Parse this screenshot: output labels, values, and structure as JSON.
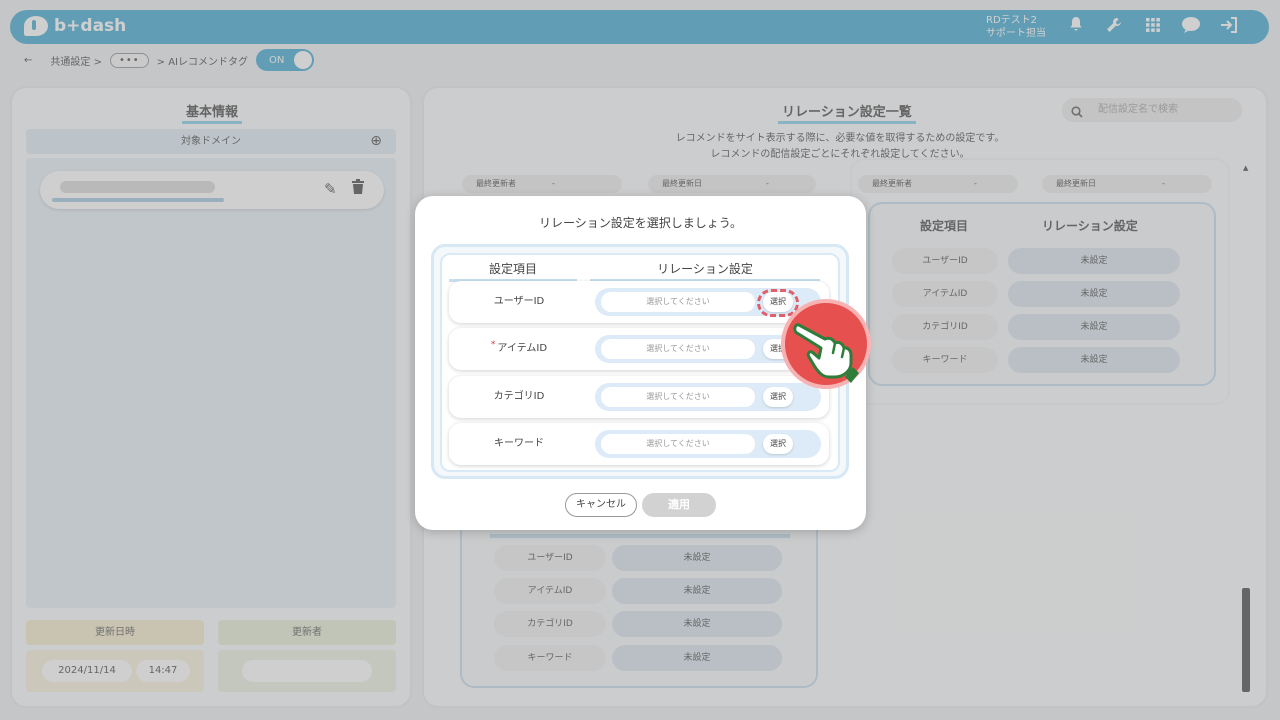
{
  "header": {
    "logo_text": "b+dash",
    "user_line1": "RDテスト2",
    "user_line2": "サポート担当",
    "icons": [
      "bell-icon",
      "wrench-icon",
      "grid-icon",
      "chat-icon",
      "logout-icon"
    ]
  },
  "breadcrumb": {
    "back": "←",
    "item1": "共通設定 >",
    "dots": "•••",
    "item2": "> AIレコメンドタグ",
    "toggle_label": "ON"
  },
  "left_panel": {
    "title": "基本情報",
    "domain_header": "対象ドメイン",
    "updated_at_label": "更新日時",
    "updater_label": "更新者",
    "date": "2024/11/14",
    "time": "14:47"
  },
  "right_panel": {
    "title": "リレーション設定一覧",
    "search_placeholder": "配信設定名で検索",
    "desc_line1": "レコメンドをサイト表示する際に、必要な値を取得するための設定です。",
    "desc_line2": "レコメンドの配信設定ごとにそれぞれ設定してください。",
    "last_updater": "最終更新者",
    "last_updated": "最終更新日",
    "dash": "-",
    "col_item": "設定項目",
    "col_relation": "リレーション設定",
    "rows": [
      {
        "label": "ユーザーID",
        "value": "未設定"
      },
      {
        "label": "アイテムID",
        "value": "未設定"
      },
      {
        "label": "カテゴリID",
        "value": "未設定"
      },
      {
        "label": "キーワード",
        "value": "未設定"
      }
    ]
  },
  "modal": {
    "title": "リレーション設定を選択しましょう。",
    "col_item": "設定項目",
    "col_relation": "リレーション設定",
    "required_mark": "*",
    "rows": [
      {
        "label": "ユーザーID",
        "placeholder": "選択してください",
        "button": "選択"
      },
      {
        "label": "アイテムID",
        "placeholder": "選択してください",
        "button": "選択"
      },
      {
        "label": "カテゴリID",
        "placeholder": "選択してください",
        "button": "選択"
      },
      {
        "label": "キーワード",
        "placeholder": "選択してください",
        "button": "選択"
      }
    ],
    "cancel": "キャンセル",
    "apply": "適用"
  },
  "colors": {
    "brand": "#4eb1d6",
    "required": "#e0324a",
    "pointer_bg": "#e6504f",
    "pointer_hand": "#2e7d3a"
  }
}
